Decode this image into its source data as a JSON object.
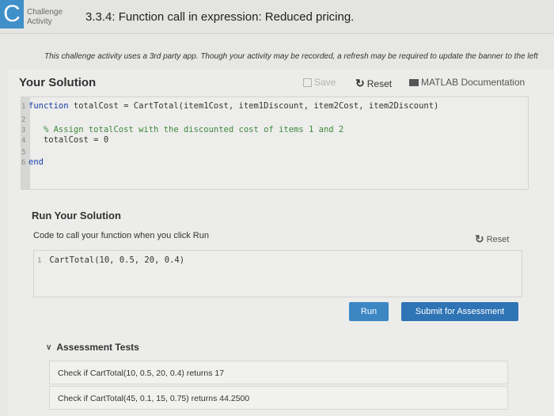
{
  "header": {
    "logo_letter": "C",
    "badge_line1": "Challenge",
    "badge_line2": "Activity",
    "title": "3.3.4: Function call in expression: Reduced pricing."
  },
  "notice": "This challenge activity uses a 3rd party app. Though your activity may be recorded, a refresh may be required to update the banner to the left",
  "solution": {
    "heading": "Your Solution",
    "save_label": "Save",
    "reset_label": "Reset",
    "doc_label": "MATLAB Documentation",
    "lines": [
      {
        "n": "1",
        "kw": "function",
        "text": " totalCost = CartTotal(item1Cost, item1Discount, item2Cost, item2Discount)"
      },
      {
        "n": "2",
        "kw": "",
        "text": ""
      },
      {
        "n": "3",
        "kw": "",
        "comment": "   % Assign totalCost with the discounted cost of items 1 and 2"
      },
      {
        "n": "4",
        "kw": "",
        "text": "   totalCost = 0"
      },
      {
        "n": "5",
        "kw": "",
        "text": ""
      },
      {
        "n": "6",
        "kw": "end",
        "text": ""
      }
    ]
  },
  "run": {
    "heading": "Run Your Solution",
    "description": "Code to call your function when you click Run",
    "reset_label": "Reset",
    "call_line_number": "1",
    "call_code": "CartTotal(10, 0.5, 20, 0.4)",
    "run_label": "Run",
    "submit_label": "Submit for Assessment"
  },
  "tests": {
    "heading": "Assessment Tests",
    "items": [
      "Check if CartTotal(10, 0.5, 20, 0.4) returns 17",
      "Check if CartTotal(45, 0.1, 15, 0.75) returns 44.2500"
    ]
  }
}
